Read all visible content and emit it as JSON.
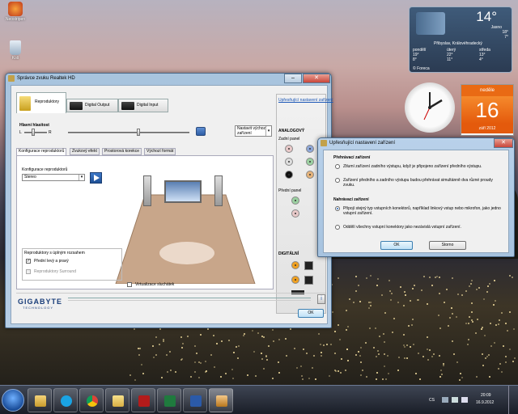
{
  "desktop": {
    "icons": [
      {
        "label": "Neostripen",
        "icon": "app-icon"
      },
      {
        "label": "Koš",
        "icon": "recycle-bin-icon"
      }
    ]
  },
  "weather_gadget": {
    "temperature": "14°",
    "condition": "Jasno",
    "high": "18°",
    "low": "7°",
    "location": "Přibyslav, Královéhradecký",
    "forecast": [
      {
        "day": "pondělí",
        "high": "19°",
        "low": "8°"
      },
      {
        "day": "úterý",
        "high": "22°",
        "low": "11°"
      },
      {
        "day": "středa",
        "high": "13°",
        "low": "4°"
      }
    ],
    "provider": "© Foreca"
  },
  "calendar_gadget": {
    "weekday": "neděle",
    "day": "16",
    "month_year": "září 2012"
  },
  "main_window": {
    "title": "Správce zvuku Realtek HD",
    "tabs": [
      {
        "label": "Reproduktory"
      },
      {
        "label": "Digital Output"
      },
      {
        "label": "Digital Input"
      }
    ],
    "volume": {
      "label": "Hlavní hlasitost",
      "left": "L",
      "right": "R",
      "balance_fraction": 0.4,
      "level_fraction": 0.5,
      "default_device_select": "Nastavit výchozí zařízení"
    },
    "subtabs": [
      {
        "label": "Konfigurace reproduktorů"
      },
      {
        "label": "Zvukový efekt"
      },
      {
        "label": "Prostorová korekce"
      },
      {
        "label": "Výchozí formát"
      }
    ],
    "speaker_config": {
      "label": "Konfigurace reproduktorů",
      "value": "Stereo",
      "play_icon": "play-icon"
    },
    "fullrange": {
      "label": "Reproduktory s úplným rozsahem",
      "options": [
        {
          "label": "Přední levý a pravý",
          "checked": true
        },
        {
          "label": "Reproduktory Surround",
          "checked": false
        }
      ]
    },
    "virtualization": {
      "label": "Virtualizace sluchátek",
      "checked": false
    },
    "side": {
      "advanced_link": "Upřesňující nastavení zařízení",
      "analog_label": "ANALOGOVÝ",
      "back_panel": "Zadní panel",
      "front_panel": "Přední panel",
      "digital_label": "DIGITÁLNÍ"
    },
    "brand": "GIGABYTE",
    "brand_sub": "TECHNOLOGY",
    "ok_button": "OK",
    "info_icon": "info-icon",
    "close_label": "x"
  },
  "dialog": {
    "title": "Upřesňující nastavení zařízení",
    "playback_heading": "Přehrávací zařízení",
    "playback_options": [
      {
        "label": "Ztlumí zařízení zadního výstupu, když je připojeno zařízení předního výstupu.",
        "selected": false
      },
      {
        "label": "Zařízení předního a zadního výstupu budou přehrávat simultánně dva různé proudy zvuku.",
        "selected": false
      }
    ],
    "record_heading": "Nahrávací zařízení",
    "record_options": [
      {
        "label": "Připojí stejný typ vstupních konektorů, například linkový vstup nebo mikrofon, jako jedno vstupní zařízení.",
        "selected": true
      },
      {
        "label": "Oddělí všechny vstupní konektory jako nezávislá vstupní zařízení.",
        "selected": false
      }
    ],
    "ok_button": "OK",
    "cancel_button": "Storno"
  },
  "taskbar": {
    "pinned": [
      {
        "icon": "explorer-icon"
      },
      {
        "icon": "skype-icon"
      },
      {
        "icon": "chrome-icon"
      },
      {
        "icon": "folder-icon"
      },
      {
        "icon": "acrobat-icon"
      },
      {
        "icon": "excel-icon"
      },
      {
        "icon": "word-icon"
      },
      {
        "icon": "realtek-audio-icon"
      }
    ],
    "language": "CS",
    "time": "20:09",
    "date": "16.9.2012"
  },
  "colors": {
    "accent_blue": "#1a56b6",
    "calendar_orange": "#e96a14",
    "window_frame": "#a8c4de"
  }
}
